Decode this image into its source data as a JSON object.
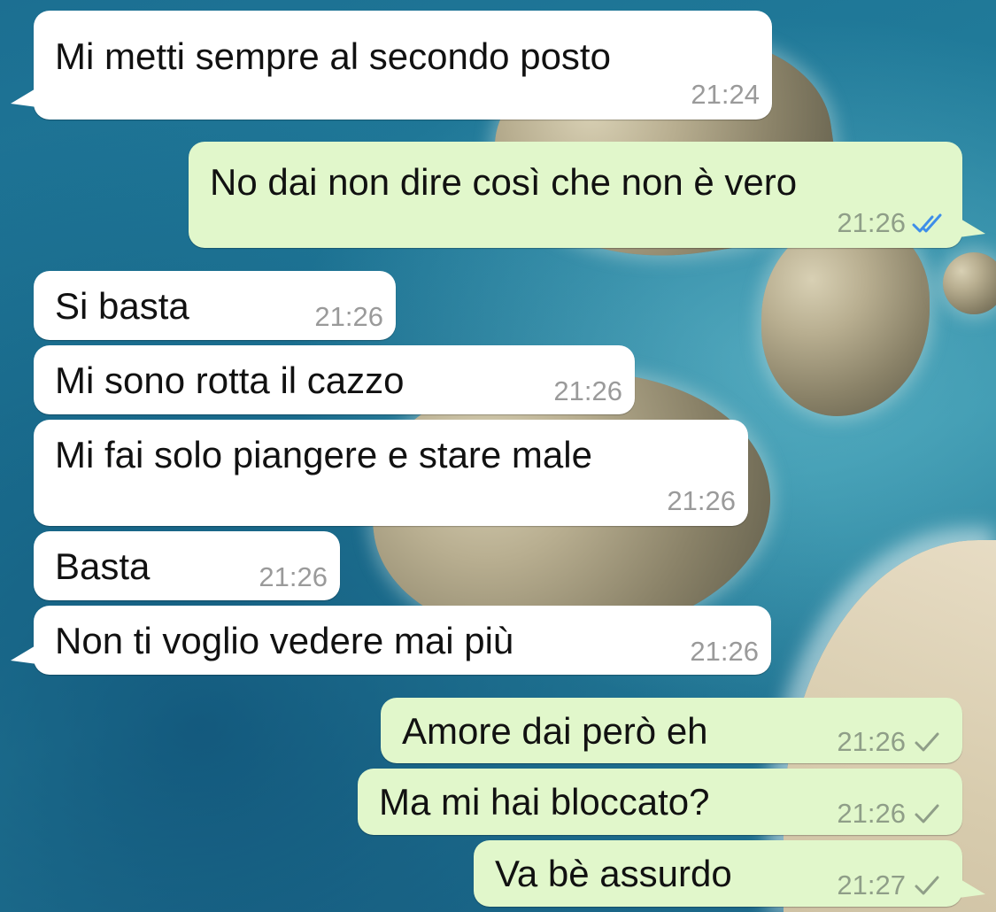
{
  "colors": {
    "incoming_bubble": "#ffffff",
    "outgoing_bubble": "#e1f7cb",
    "read_check": "#3e8ee9",
    "sent_check": "#8f9e88"
  },
  "messages": [
    {
      "text": "Mi metti sempre al secondo posto",
      "time": "21:24",
      "direction": "incoming"
    },
    {
      "text": "No dai non dire così che non è vero",
      "time": "21:26",
      "direction": "outgoing",
      "status": "read"
    },
    {
      "text": "Si basta",
      "time": "21:26",
      "direction": "incoming"
    },
    {
      "text": "Mi sono rotta il cazzo",
      "time": "21:26",
      "direction": "incoming"
    },
    {
      "text": "Mi fai solo piangere e stare male",
      "time": "21:26",
      "direction": "incoming"
    },
    {
      "text": "Basta",
      "time": "21:26",
      "direction": "incoming"
    },
    {
      "text": "Non ti voglio vedere mai più",
      "time": "21:26",
      "direction": "incoming"
    },
    {
      "text": "Amore dai però eh",
      "time": "21:26",
      "direction": "outgoing",
      "status": "sent"
    },
    {
      "text": "Ma mi hai bloccato?",
      "time": "21:26",
      "direction": "outgoing",
      "status": "sent"
    },
    {
      "text": "Va bè assurdo",
      "time": "21:27",
      "direction": "outgoing",
      "status": "sent"
    }
  ]
}
